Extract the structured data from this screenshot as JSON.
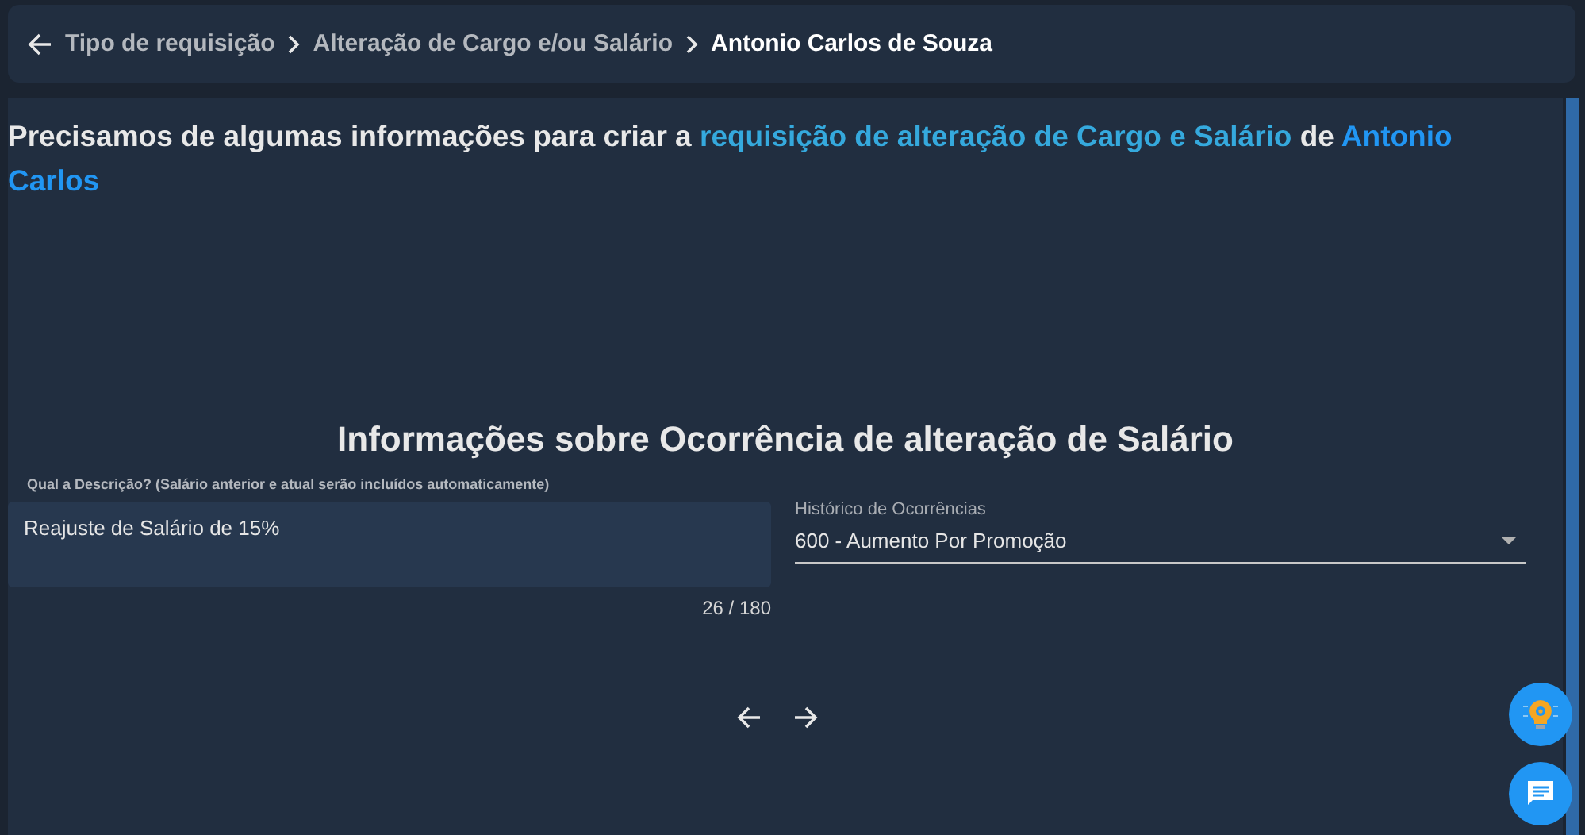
{
  "breadcrumb": [
    {
      "label": "Tipo de requisição",
      "selected": false
    },
    {
      "label": "Alteração de Cargo e/ou Salário",
      "selected": false
    },
    {
      "label": "Antonio Carlos de Souza",
      "selected": true
    }
  ],
  "intro": [
    {
      "text": "Precisamos de algumas informações para criar a ",
      "kind": "plain"
    },
    {
      "text": "requisição de alteração de Cargo e Salário",
      "kind": "highlight"
    },
    {
      "text": " de ",
      "kind": "plain"
    },
    {
      "text": "Antonio Carlos",
      "kind": "name"
    }
  ],
  "section_title": "Informações sobre Ocorrência de alteração de Salário",
  "description": {
    "label": "Qual a Descrição? (Salário anterior e atual serão incluídos automaticamente)",
    "value": "Reajuste de Salário de 15%",
    "counter": "26 / 180"
  },
  "history_select": {
    "label": "Histórico de Ocorrências",
    "value": "600 - Aumento Por Promoção"
  }
}
